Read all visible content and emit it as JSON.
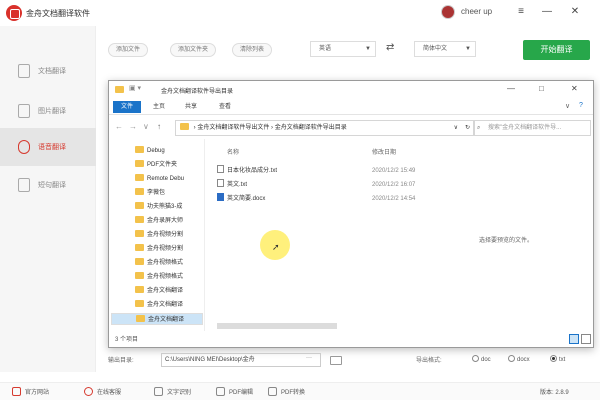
{
  "app": {
    "title": "金舟文档翻译软件",
    "user": "cheer up",
    "version": "2.8.9"
  },
  "window_controls": {
    "menu": "≡",
    "minimize": "—",
    "maximize": "□",
    "close": "✕"
  },
  "sidebar": {
    "items": [
      {
        "label": "文档翻译",
        "icon": "document-icon",
        "active": false
      },
      {
        "label": "图片翻译",
        "icon": "image-icon",
        "active": false
      },
      {
        "label": "语音翻译",
        "icon": "microphone-icon",
        "active": true
      },
      {
        "label": "短句翻译",
        "icon": "text-icon",
        "active": false
      }
    ]
  },
  "toolbar": {
    "add_file": "添加文件",
    "add_folder": "添加文件夹",
    "clear_list": "清除列表",
    "source_lang": "英语",
    "swap_icon": "swap-icon",
    "target_lang": "简体中文",
    "start": "开始翻译"
  },
  "dialog": {
    "title": "金舟文档翻译软件导出目录",
    "tabs": [
      "文件",
      "主页",
      "共享",
      "查看"
    ],
    "path": [
      "金舟文档翻译软件导出文件",
      "金舟文档翻译软件导出目录"
    ],
    "search_placeholder": "搜索\"金舟文档翻译软件导...",
    "tree": [
      "Debug",
      "PDF文件夹",
      "Remote Debu",
      "李薇包",
      "功夫熊猫3-成",
      "金舟录屏大师",
      "金舟视频分割",
      "金舟视频分割",
      "金舟视频格式",
      "金舟视频格式",
      "金舟文档翻译",
      "金舟文档翻译",
      "金舟文档翻译"
    ],
    "columns": {
      "name": "名称",
      "date": "修改日期"
    },
    "files": [
      {
        "name": "日本化妆品成分.txt",
        "date": "2020/12/2 15:49",
        "type": "txt"
      },
      {
        "name": "英文.txt",
        "date": "2020/12/2 16:07",
        "type": "txt"
      },
      {
        "name": "英文简要.docx",
        "date": "2020/12/2 14:54",
        "type": "docx"
      }
    ],
    "preview_text": "选择要预览的文件。",
    "status": "3 个项目"
  },
  "output": {
    "label": "输出目录:",
    "path": "C:\\Users\\NING MEI\\Desktop\\金舟",
    "more": "···",
    "format_label": "导出格式:",
    "formats": [
      "doc",
      "docx",
      "txt"
    ],
    "selected_format": "txt"
  },
  "bottom": {
    "items": [
      "官方网站",
      "在线客服",
      "文字识别",
      "PDF编辑",
      "PDF转换"
    ],
    "version_label": "版本:"
  },
  "colors": {
    "accent": "#d63a2f",
    "start_button": "#27a74a",
    "ribbon_file": "#1a73c9",
    "cursor_highlight": "#ffeb50"
  }
}
